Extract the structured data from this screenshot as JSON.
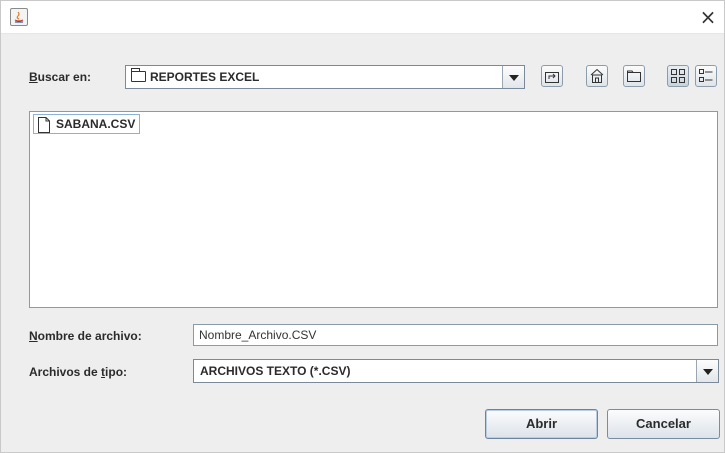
{
  "window": {
    "close_glyph": "×",
    "app_icon": "java-app-icon"
  },
  "look_in": {
    "label_mnemonic": "B",
    "label_rest": "uscar en:",
    "value": "REPORTES EXCEL",
    "icon": "folder-icon"
  },
  "toolbar": [
    {
      "name": "up-folder",
      "icon": "up-one-level-icon"
    },
    {
      "name": "home",
      "icon": "home-icon"
    },
    {
      "name": "new-folder",
      "icon": "new-folder-icon"
    },
    {
      "name": "list-view",
      "icon": "list-view-icon",
      "active": true
    },
    {
      "name": "details-view",
      "icon": "details-view-icon"
    }
  ],
  "files": [
    {
      "name": "SABANA.CSV",
      "icon": "file-icon"
    }
  ],
  "file_name": {
    "label_mnemonic": "N",
    "label_rest": "ombre de archivo:",
    "value": "Nombre_Archivo.CSV"
  },
  "file_type": {
    "label_prefix": "Archivos de ",
    "label_mnemonic": "t",
    "label_rest": "ipo:",
    "value": "ARCHIVOS TEXTO (*.CSV)"
  },
  "buttons": {
    "open_label": "Abrir",
    "cancel_label": "Cancelar"
  }
}
